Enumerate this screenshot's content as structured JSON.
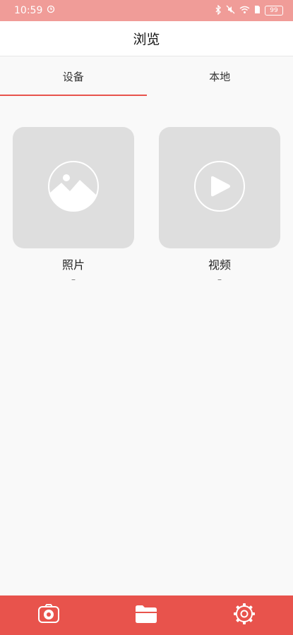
{
  "status_bar": {
    "time": "10:59",
    "battery": "99"
  },
  "header": {
    "title": "浏览"
  },
  "tabs": [
    {
      "label": "设备",
      "active": true
    },
    {
      "label": "本地",
      "active": false
    }
  ],
  "categories": [
    {
      "label": "照片",
      "count": "–",
      "icon": "image-icon"
    },
    {
      "label": "视频",
      "count": "–",
      "icon": "video-play-icon"
    }
  ],
  "bottom_nav": [
    {
      "icon": "camera-icon"
    },
    {
      "icon": "folder-icon",
      "active": true
    },
    {
      "icon": "gear-icon"
    }
  ],
  "colors": {
    "accent": "#e8534c",
    "status_bar": "#f09c98",
    "placeholder": "#dedede"
  }
}
